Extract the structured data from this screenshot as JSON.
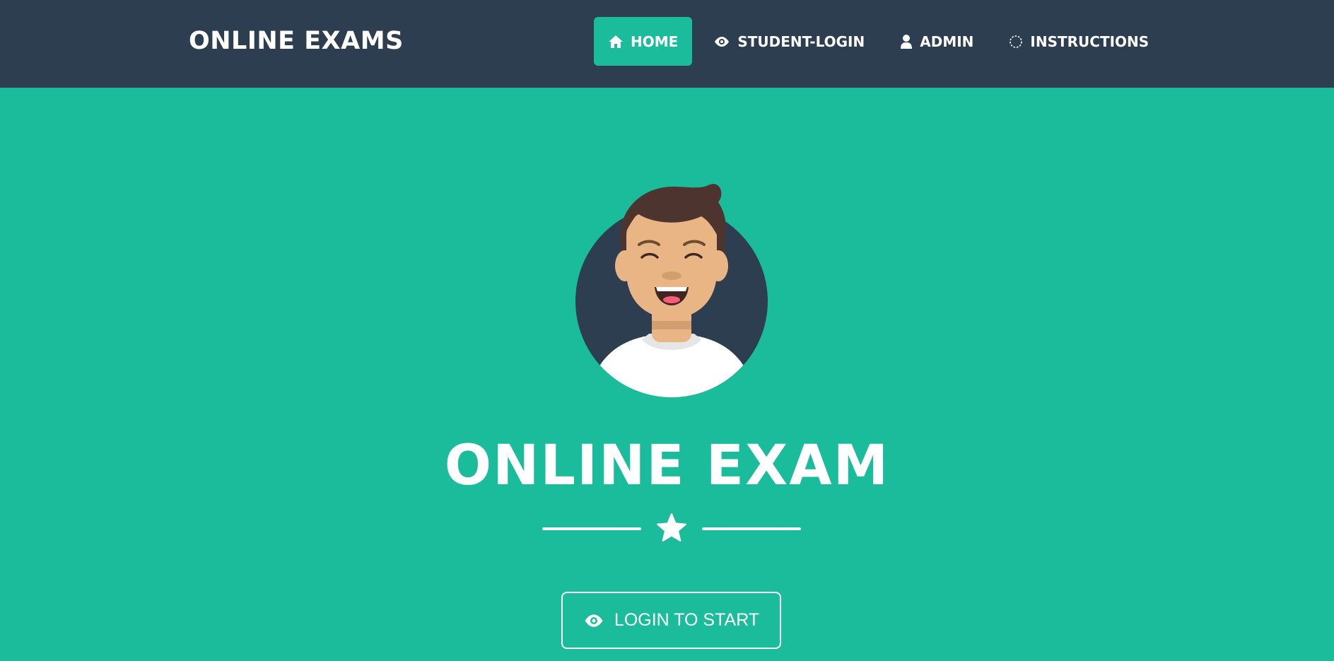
{
  "navbar": {
    "brand": "ONLINE EXAMS",
    "items": [
      {
        "label": "HOME",
        "icon": "home-icon",
        "active": true
      },
      {
        "label": "STUDENT-LOGIN",
        "icon": "eye-icon",
        "active": false
      },
      {
        "label": "ADMIN",
        "icon": "user-icon",
        "active": false
      },
      {
        "label": "INSTRUCTIONS",
        "icon": "dashed-circle-icon",
        "active": false
      }
    ]
  },
  "hero": {
    "avatar": "avatar-illustration",
    "title": "ONLINE EXAM",
    "divider_icon": "star-icon",
    "login_button": {
      "label": "LOGIN TO START",
      "icon": "eye-icon"
    }
  },
  "colors": {
    "navbar_bg": "#2c3e50",
    "primary": "#1abc9c",
    "text": "#ffffff"
  }
}
